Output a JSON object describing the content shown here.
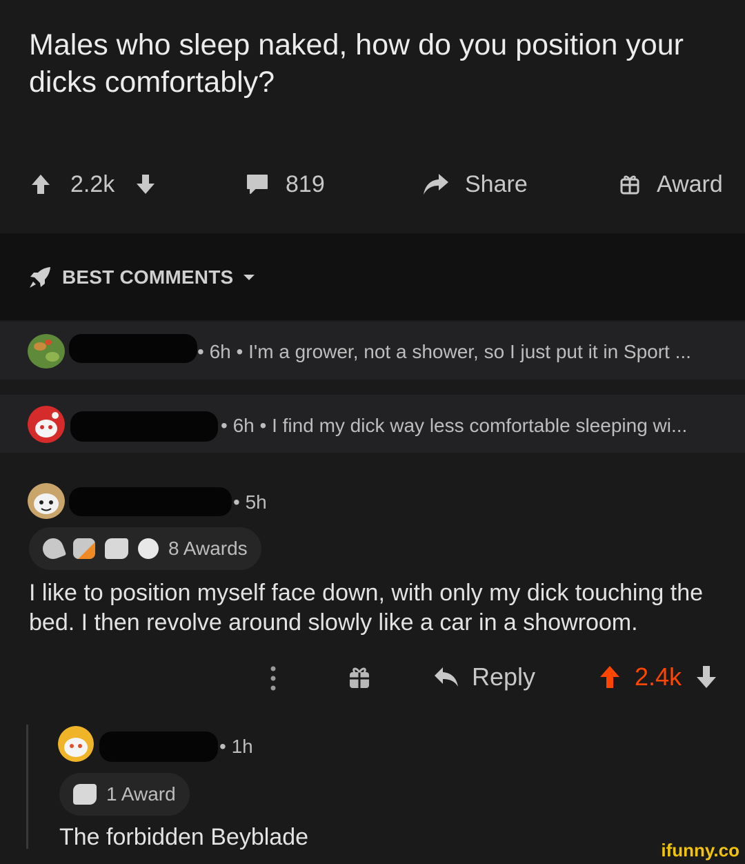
{
  "post": {
    "title": "Males who sleep naked, how do you position your dicks comfortably?",
    "score": "2.2k",
    "comments": "819",
    "share": "Share",
    "award": "Award"
  },
  "sort": {
    "label": "BEST COMMENTS"
  },
  "comments": [
    {
      "meta": "• 6h • I'm a grower, not a shower, so I just put it in Sport ..."
    },
    {
      "meta": "• 6h • I find my dick way less comfortable sleeping wi..."
    },
    {
      "meta": "• 5h",
      "awards": "8 Awards",
      "body": "I like to position myself face down, with only my dick touching the bed. I then revolve around slowly like a car in a showroom.",
      "reply": "Reply",
      "score": "2.4k"
    }
  ],
  "reply": {
    "meta": "• 1h",
    "awards": "1 Award",
    "body": "The forbidden Beyblade"
  },
  "watermark": "ifunny.co",
  "colors": {
    "upvote": "#ff4500",
    "background": "#1a1a1b",
    "sortbar": "#111112",
    "collapsed": "#222224"
  }
}
